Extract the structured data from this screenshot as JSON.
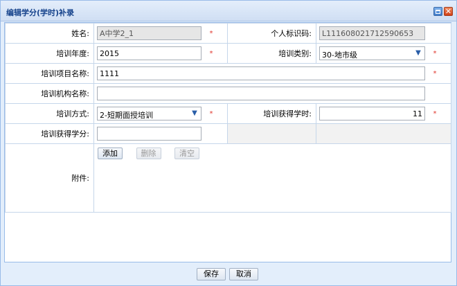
{
  "window": {
    "title": "编辑学分(学时)补录"
  },
  "form": {
    "name": {
      "label": "姓名:",
      "value": "A中学2_1"
    },
    "personal_id": {
      "label": "个人标识码:",
      "value": "L111608021712590653"
    },
    "training_year": {
      "label": "培训年度:",
      "value": "2015"
    },
    "training_category": {
      "label": "培训类别:",
      "value": "30-地市级"
    },
    "project_name": {
      "label": "培训项目名称:",
      "value": "1111"
    },
    "institution_name": {
      "label": "培训机构名称:",
      "value": ""
    },
    "training_method": {
      "label": "培训方式:",
      "value": "2-短期面授培训"
    },
    "training_hours": {
      "label": "培训获得学时:",
      "value": "11"
    },
    "training_credits": {
      "label": "培训获得学分:",
      "value": ""
    },
    "attachment": {
      "label": "附件:",
      "add_label": "添加",
      "delete_label": "删除",
      "clear_label": "清空"
    },
    "required_mark": "*"
  },
  "footer": {
    "save_label": "保存",
    "cancel_label": "取消"
  },
  "colors": {
    "title_text": "#15428b",
    "required": "#e0362c",
    "border": "#c5d6ea"
  }
}
